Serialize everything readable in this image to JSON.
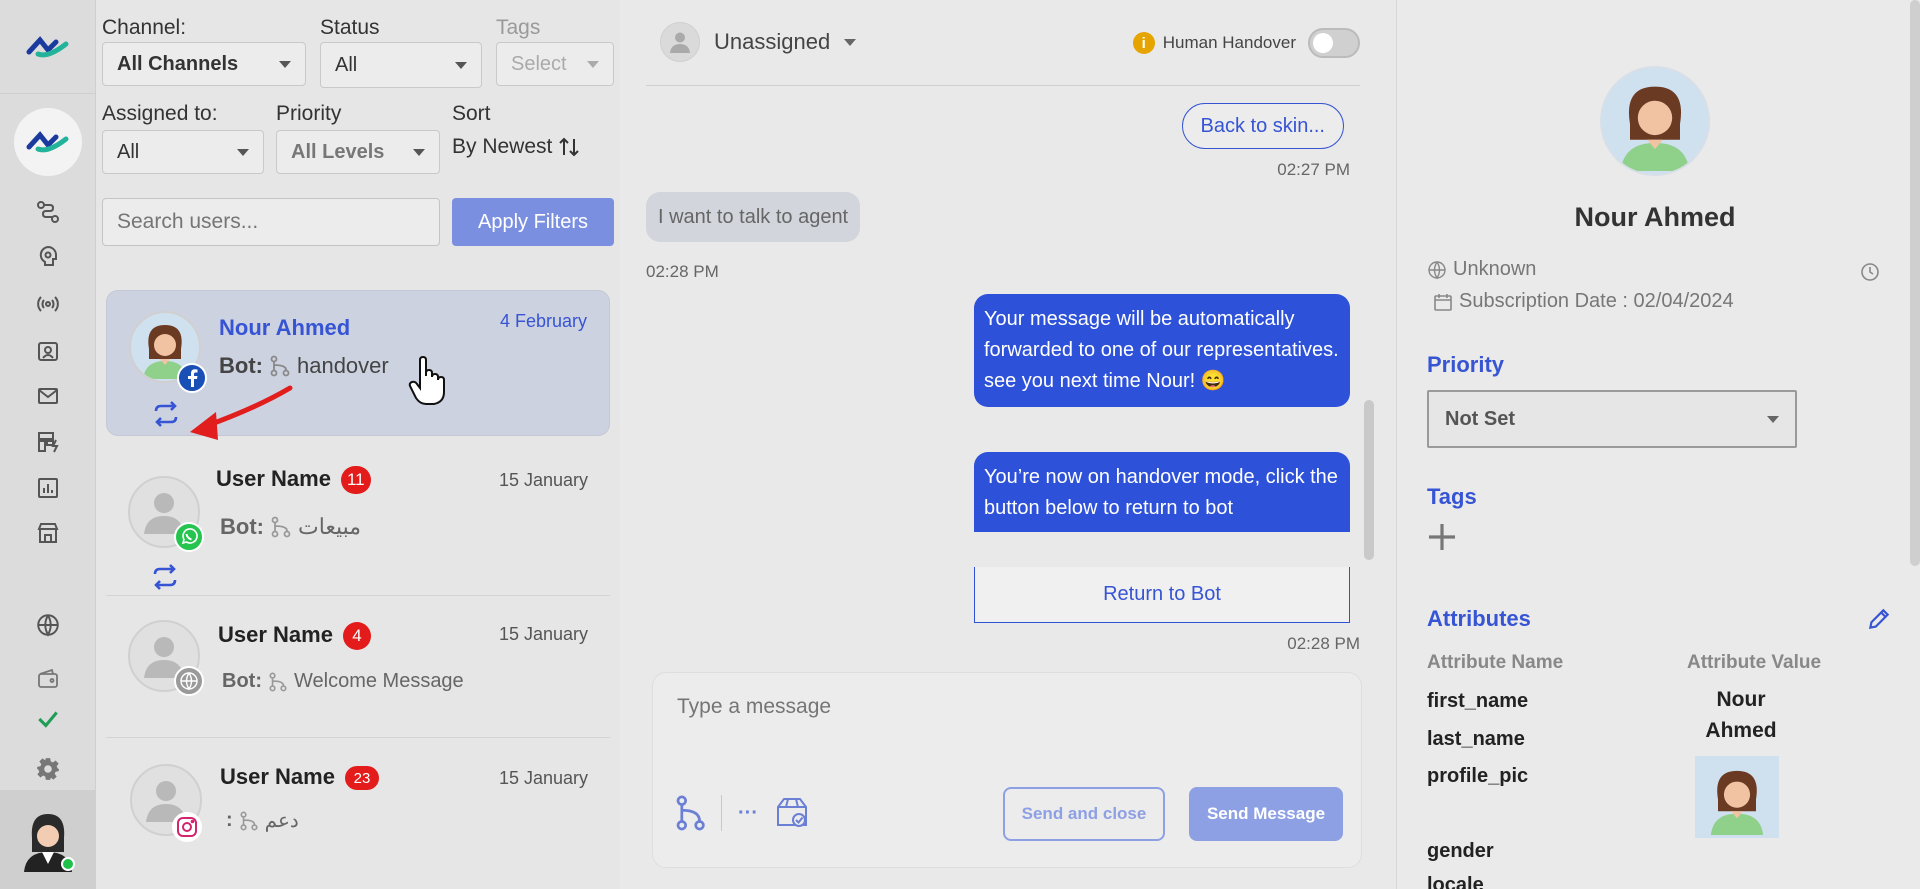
{
  "colors": {
    "accent": "#3654d4",
    "bubble_out": "#2d51d8",
    "badge_red": "#e31b1b",
    "apply_bg": "#7b8fe0"
  },
  "rail": {
    "icons": [
      "logo-icon",
      "workspace-logo-icon",
      "flows-icon",
      "ai-brain-icon",
      "broadcast-icon",
      "contacts-icon",
      "mail-icon",
      "automation-icon",
      "analytics-icon",
      "store-icon",
      "language-icon",
      "wallet-icon",
      "check-icon",
      "settings-icon",
      "user-avatar"
    ]
  },
  "filters": {
    "channel_label": "Channel:",
    "channel_value": "All Channels",
    "status_label": "Status",
    "status_value": "All",
    "tags_label": "Tags",
    "tags_value": "Select",
    "assigned_label": "Assigned to:",
    "assigned_value": "All",
    "priority_label": "Priority",
    "priority_value": "All Levels",
    "sort_label": "Sort",
    "sort_value": "By Newest",
    "search_placeholder": "Search users...",
    "apply_label": "Apply Filters"
  },
  "conversations": [
    {
      "name": "Nour Ahmed",
      "date": "4 February",
      "bot_label": "Bot:",
      "bot_text": "handover",
      "channel": "facebook",
      "count": "",
      "active": true
    },
    {
      "name": "User Name",
      "date": "15 January",
      "bot_label": "Bot:",
      "bot_text": "مبيعات",
      "channel": "whatsapp",
      "count": "11",
      "active": false
    },
    {
      "name": "User Name",
      "date": "15 January",
      "bot_label": "Bot:",
      "bot_text": "Welcome Message",
      "channel": "web",
      "count": "4",
      "active": false
    },
    {
      "name": "User Name",
      "date": "15 January",
      "bot_label": ":",
      "bot_text": "دعم",
      "channel": "instagram",
      "count": "23",
      "active": false
    }
  ],
  "chat": {
    "assignee": "Unassigned",
    "human_handover_label": "Human Handover",
    "messages": {
      "back_button": "Back to skin...",
      "time1": "02:27 PM",
      "incoming": "I want to talk to agent",
      "time2": "02:28 PM",
      "out1": "Your message will be automatically forwarded to one of our representatives. see you next time Nour! 😄",
      "out2": "You’re now on handover mode, click the button below to return to bot",
      "return_button": "Return to Bot",
      "time3": "02:28 PM"
    },
    "composer_placeholder": "Type a message",
    "more_label": "···",
    "send_close_label": "Send and close",
    "send_label": "Send Message"
  },
  "profile": {
    "name": "Nour Ahmed",
    "location": "Unknown",
    "subscription": "Subscription Date : 02/04/2024",
    "priority_title": "Priority",
    "priority_value": "Not Set",
    "tags_title": "Tags",
    "attributes_title": "Attributes",
    "attr_name_header": "Attribute Name",
    "attr_value_header": "Attribute Value",
    "attributes": [
      {
        "key": "first_name",
        "value": "Nour"
      },
      {
        "key": "last_name",
        "value": "Ahmed"
      },
      {
        "key": "profile_pic",
        "value": ""
      },
      {
        "key": "gender",
        "value": ""
      },
      {
        "key": "locale",
        "value": ""
      }
    ]
  }
}
